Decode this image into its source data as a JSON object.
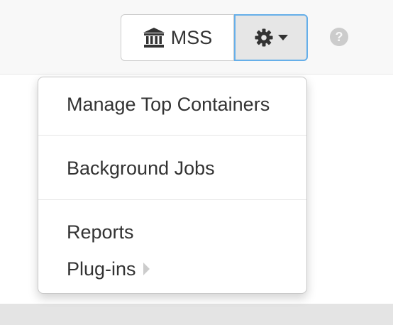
{
  "toolbar": {
    "repository_label": "MSS",
    "repository_icon": "bank-icon",
    "settings_icon": "gear-icon",
    "help_icon": "question-circle-icon"
  },
  "menu": {
    "items": [
      {
        "label": "Manage Top Containers"
      },
      {
        "label": "Background Jobs"
      },
      {
        "label": "Reports"
      },
      {
        "label": "Plug-ins",
        "has_submenu": true
      }
    ]
  },
  "colors": {
    "focus_border": "#66afe9",
    "navbar_bg": "#f8f8f8",
    "help_icon": "#cccccc"
  }
}
